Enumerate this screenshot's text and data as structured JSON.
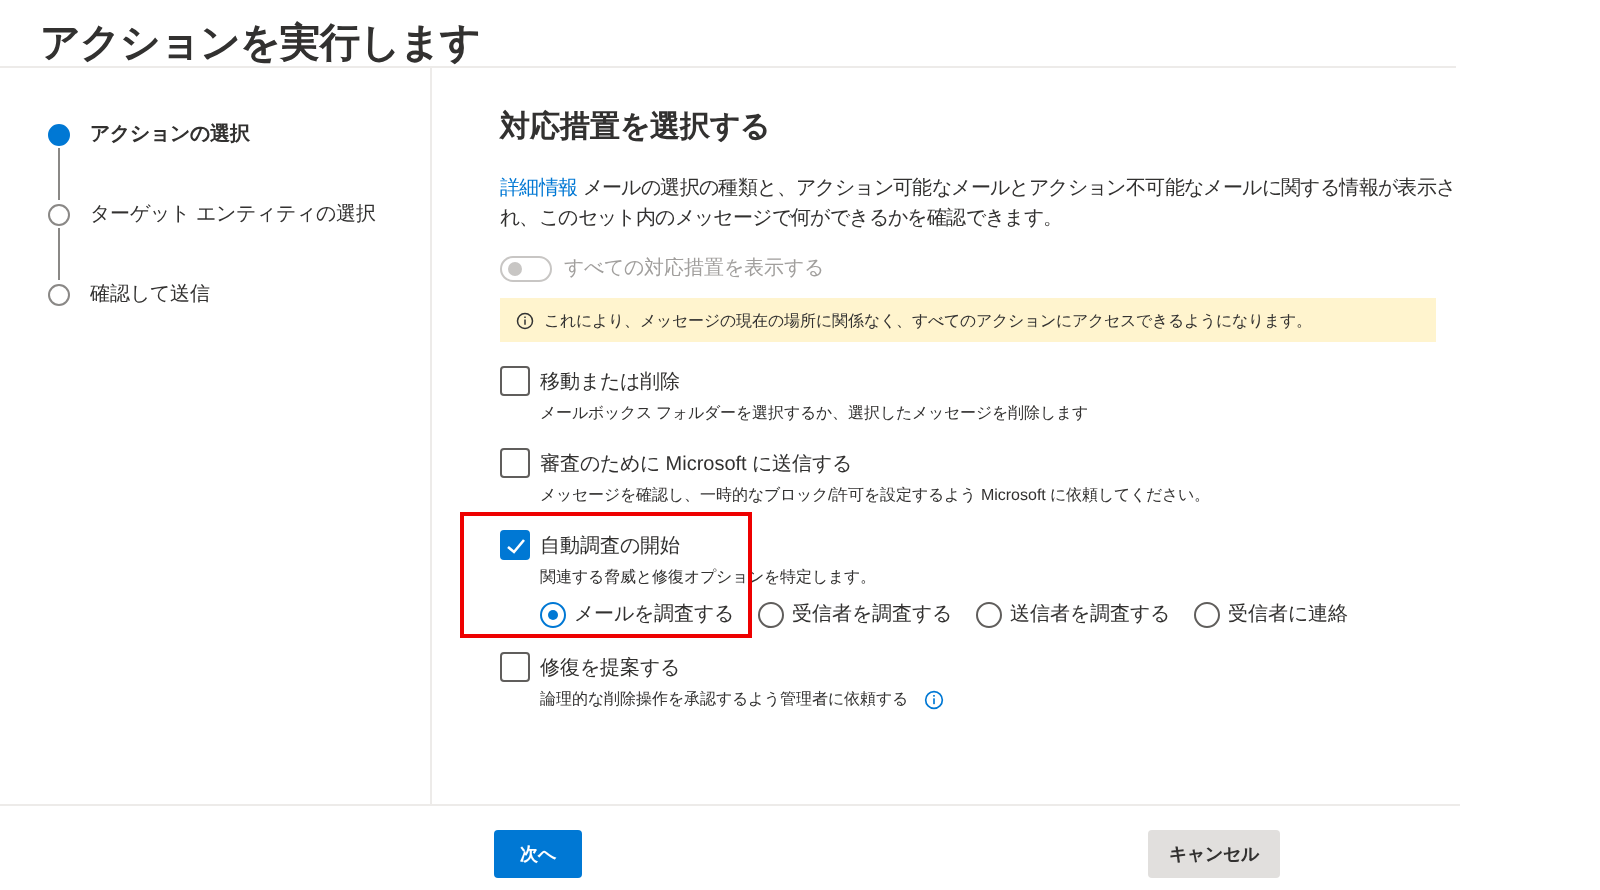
{
  "window": {
    "title": "アクションを実行します"
  },
  "steps": [
    {
      "label": "アクションの選択",
      "selected": true
    },
    {
      "label": "ターゲット エンティティの選択",
      "selected": false
    },
    {
      "label": "確認して送信",
      "selected": false
    }
  ],
  "section": {
    "title": "対応措置を選択する",
    "link": "詳細情報",
    "description": "メールの選択の種類と、アクション可能なメールとアクション不可能なメールに関する情報が表示され、このセット内のメッセージで何ができるかを確認できます。"
  },
  "toggle": {
    "label": "すべての対応措置を表示する",
    "on": false,
    "disabled": true
  },
  "notice": "これにより、メッセージの現在の場所に関係なく、すべてのアクションにアクセスできるようになります。",
  "actions": [
    {
      "label": "移動または削除",
      "description": "メールボックス フォルダーを選択するか、選択したメッセージを削除します",
      "checked": false
    },
    {
      "label": "審査のために Microsoft に送信する",
      "description": "メッセージを確認し、一時的なブロック/許可を設定するよう Microsoft に依頼してください。",
      "checked": false
    },
    {
      "label": "自動調査の開始",
      "description": "関連する脅威と修復オプションを特定します。",
      "checked": true,
      "highlighted": true,
      "options": [
        {
          "label": "メールを調査する",
          "selected": true
        },
        {
          "label": "受信者を調査する",
          "selected": false
        },
        {
          "label": "送信者を調査する",
          "selected": false
        },
        {
          "label": "受信者に連絡",
          "selected": false
        }
      ]
    },
    {
      "label": "修復を提案する",
      "description": "論理的な削除操作を承認するよう管理者に依頼する",
      "checked": false,
      "info": true
    }
  ],
  "buttons": {
    "next": "次へ",
    "cancel": "キャンセル"
  }
}
